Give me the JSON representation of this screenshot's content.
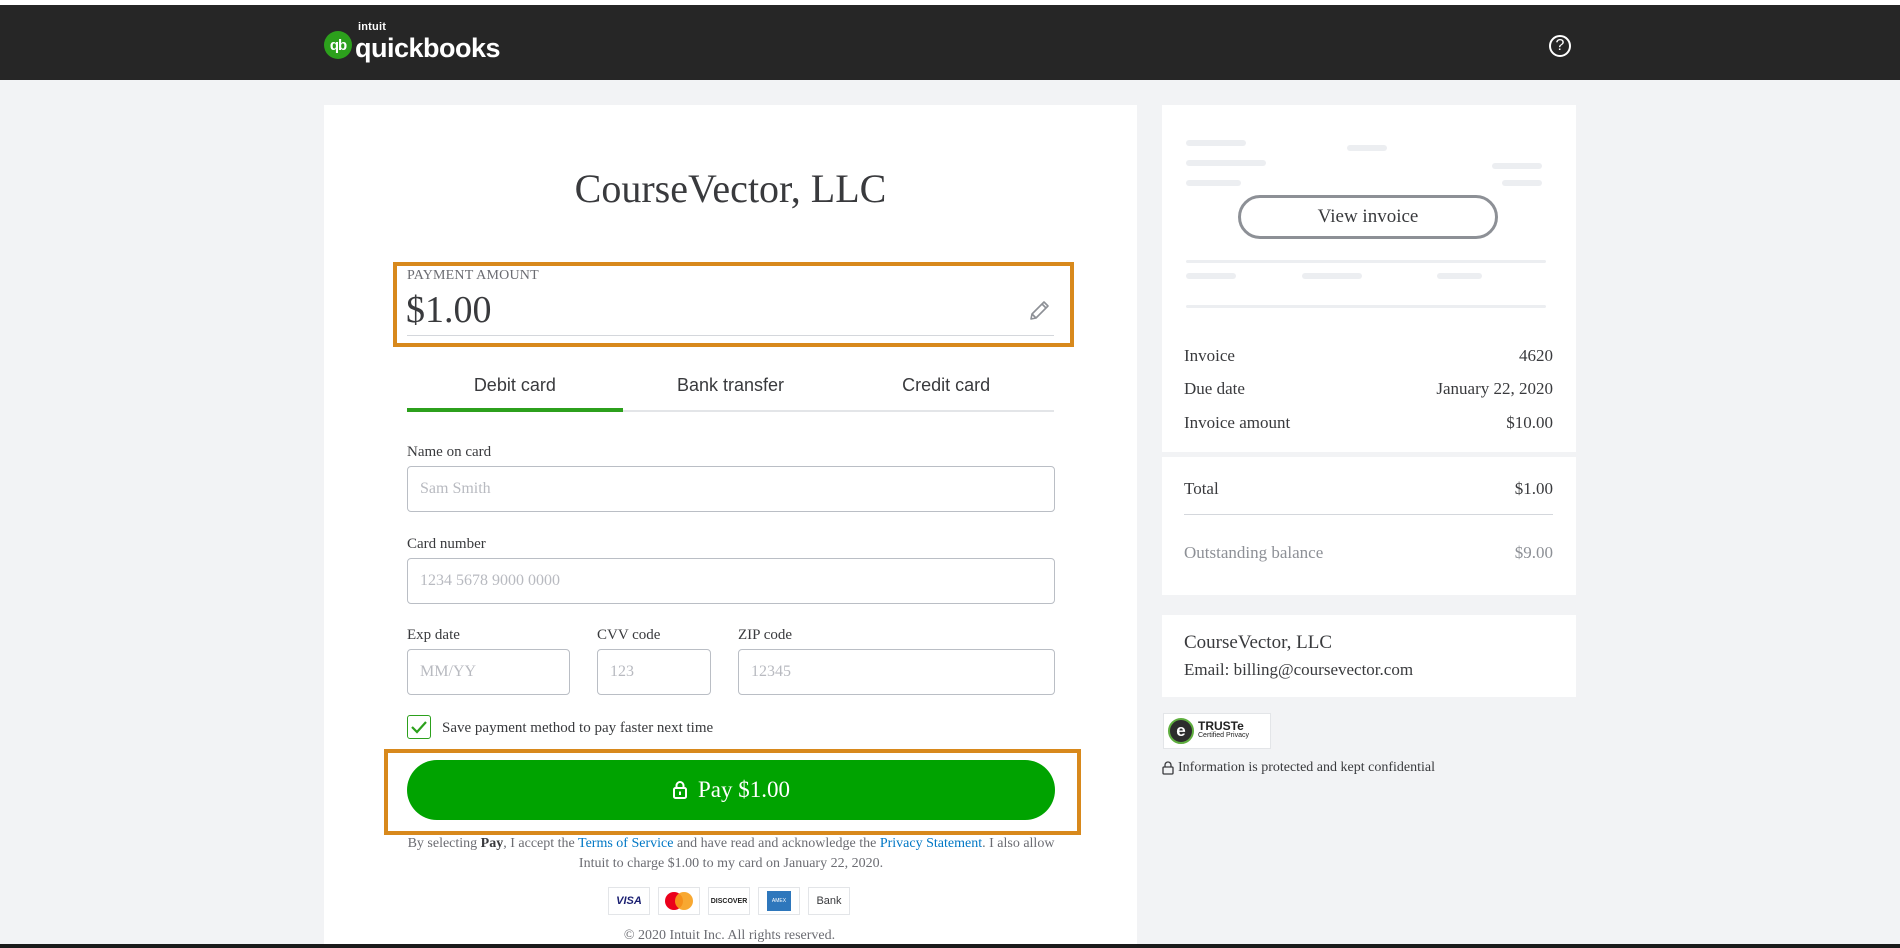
{
  "header": {
    "logo_intuit": "intuit",
    "logo_word": "quickbooks",
    "logo_badge": "qb",
    "help_icon": "?"
  },
  "main": {
    "company_title": "CourseVector, LLC",
    "payment_amount_label": "PAYMENT AMOUNT",
    "payment_amount_value": "$1.00",
    "tabs": [
      {
        "label": "Debit card",
        "active": true
      },
      {
        "label": "Bank transfer",
        "active": false
      },
      {
        "label": "Credit card",
        "active": false
      }
    ],
    "fields": {
      "name_label": "Name on card",
      "name_placeholder": "Sam Smith",
      "card_label": "Card number",
      "card_placeholder": "1234 5678 9000 0000",
      "exp_label": "Exp date",
      "exp_placeholder": "MM/YY",
      "cvv_label": "CVV code",
      "cvv_placeholder": "123",
      "zip_label": "ZIP code",
      "zip_placeholder": "12345"
    },
    "save_checkbox_label": "Save payment method to pay faster next time",
    "save_checked": true,
    "pay_button_label": "Pay $1.00",
    "legal": {
      "prefix": "By selecting ",
      "pay_word": "Pay",
      "middle1": ", I accept the ",
      "terms_link": "Terms of Service",
      "middle2": " and have read and acknowledge the ",
      "privacy_link": "Privacy Statement",
      "suffix": ". I also allow Intuit to charge $1.00 to my card on January 22, 2020."
    },
    "payment_logos": [
      "VISA",
      "mastercard",
      "DISCOVER",
      "AMEX",
      "Bank"
    ],
    "copyright": "© 2020 Intuit Inc. All rights reserved."
  },
  "sidebar": {
    "view_invoice_label": "View invoice",
    "invoice_label": "Invoice",
    "invoice_value": "4620",
    "due_date_label": "Due date",
    "due_date_value": "January 22, 2020",
    "invoice_amount_label": "Invoice amount",
    "invoice_amount_value": "$10.00",
    "total_label": "Total",
    "total_value": "$1.00",
    "outstanding_label": "Outstanding balance",
    "outstanding_value": "$9.00",
    "company_name": "CourseVector, LLC",
    "company_email": "Email: billing@coursevector.com",
    "truste_main": "TRUSTe",
    "truste_sub": "Certified Privacy",
    "secure_note": "Information is protected and kept confidential"
  },
  "colors": {
    "brand_green": "#2ca01c",
    "pay_green": "#00a300",
    "highlight_orange": "#d8891c",
    "link_blue": "#0077c5",
    "header_dark": "#262626"
  }
}
